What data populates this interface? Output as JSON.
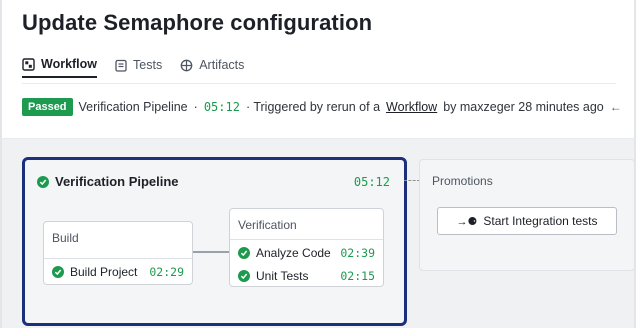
{
  "page": {
    "title": "Update Semaphore configuration"
  },
  "tabs": [
    {
      "label": "Workflow",
      "icon": "workflow-icon",
      "active": true
    },
    {
      "label": "Tests",
      "icon": "clipboard-icon",
      "active": false
    },
    {
      "label": "Artifacts",
      "icon": "artifacts-icon",
      "active": false
    }
  ],
  "status": {
    "badge": "Passed",
    "pipeline_name": "Verification Pipeline",
    "sep1": "·",
    "duration": "05:12",
    "triggered_text": "· Triggered by rerun of a",
    "workflow_link": "Workflow",
    "by_text": "by maxzeger 28 minutes ago",
    "back_icon": "←"
  },
  "pipeline": {
    "name": "Verification Pipeline",
    "duration": "05:12",
    "blocks": [
      {
        "title": "Build",
        "jobs": [
          {
            "name": "Build Project",
            "duration": "02:29"
          }
        ]
      },
      {
        "title": "Verification",
        "jobs": [
          {
            "name": "Analyze Code",
            "duration": "02:39"
          },
          {
            "name": "Unit Tests",
            "duration": "02:15"
          }
        ]
      }
    ]
  },
  "promotions": {
    "title": "Promotions",
    "button_label": "Start Integration tests",
    "button_icon": "→⚈"
  },
  "colors": {
    "accent_green": "#1c9a4e",
    "pipeline_border": "#1c2f7d"
  }
}
